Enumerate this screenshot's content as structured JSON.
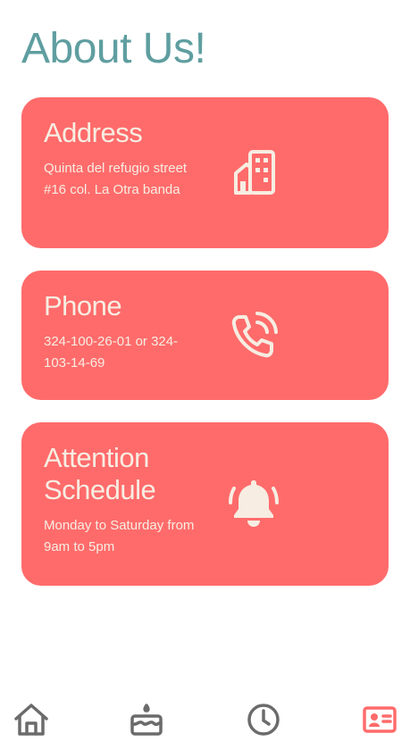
{
  "header": {
    "title_part1": "About ",
    "title_part2": "Us!"
  },
  "cards": [
    {
      "title": "Address",
      "body": "Quinta del refugio street #16 col. La Otra banda",
      "icon": "building-icon"
    },
    {
      "title": "Phone",
      "body": "324-100-26-01 or 324-103-14-69",
      "icon": "phone-ringing-icon"
    },
    {
      "title": "Attention Schedule",
      "body": "Monday to Saturday from 9am to 5pm",
      "icon": "bell-icon"
    }
  ],
  "bottom_nav": {
    "items": [
      {
        "icon": "home-icon",
        "active": false
      },
      {
        "icon": "cake-icon",
        "active": false
      },
      {
        "icon": "clock-icon",
        "active": false
      },
      {
        "icon": "contact-card-icon",
        "active": true
      }
    ]
  },
  "colors": {
    "accent_title": "#5f9ea0",
    "card_background": "#ff6b6b",
    "card_text": "#f7ede2",
    "nav_inactive": "#6b6b6b",
    "nav_active": "#ff6b6b"
  }
}
